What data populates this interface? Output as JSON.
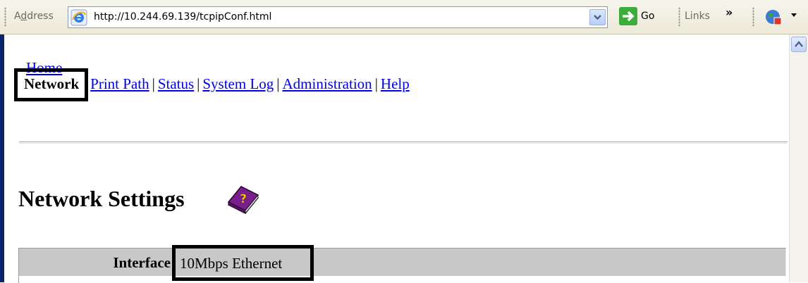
{
  "browser": {
    "address_label": "Address",
    "url": "http://10.244.69.139/tcpipConf.html",
    "go_label": "Go",
    "links_label": "Links",
    "links_chevron": "»"
  },
  "nav": {
    "home": "Home",
    "items": [
      {
        "label": "Network"
      },
      {
        "label": "Print Path"
      },
      {
        "label": "Status"
      },
      {
        "label": "System Log"
      },
      {
        "label": "Administration"
      },
      {
        "label": "Help"
      }
    ],
    "separator": "|"
  },
  "page": {
    "title": "Network Settings"
  },
  "settings": {
    "interface_label": "Interface",
    "interface_value": "10Mbps Ethernet"
  },
  "icons": {
    "ie": "internet-explorer-icon",
    "go": "green-arrow-icon",
    "help": "help-book-icon"
  },
  "colors": {
    "link": "#0000ee",
    "table_row": "#c8c8c8",
    "highlight_box": "#000000"
  }
}
